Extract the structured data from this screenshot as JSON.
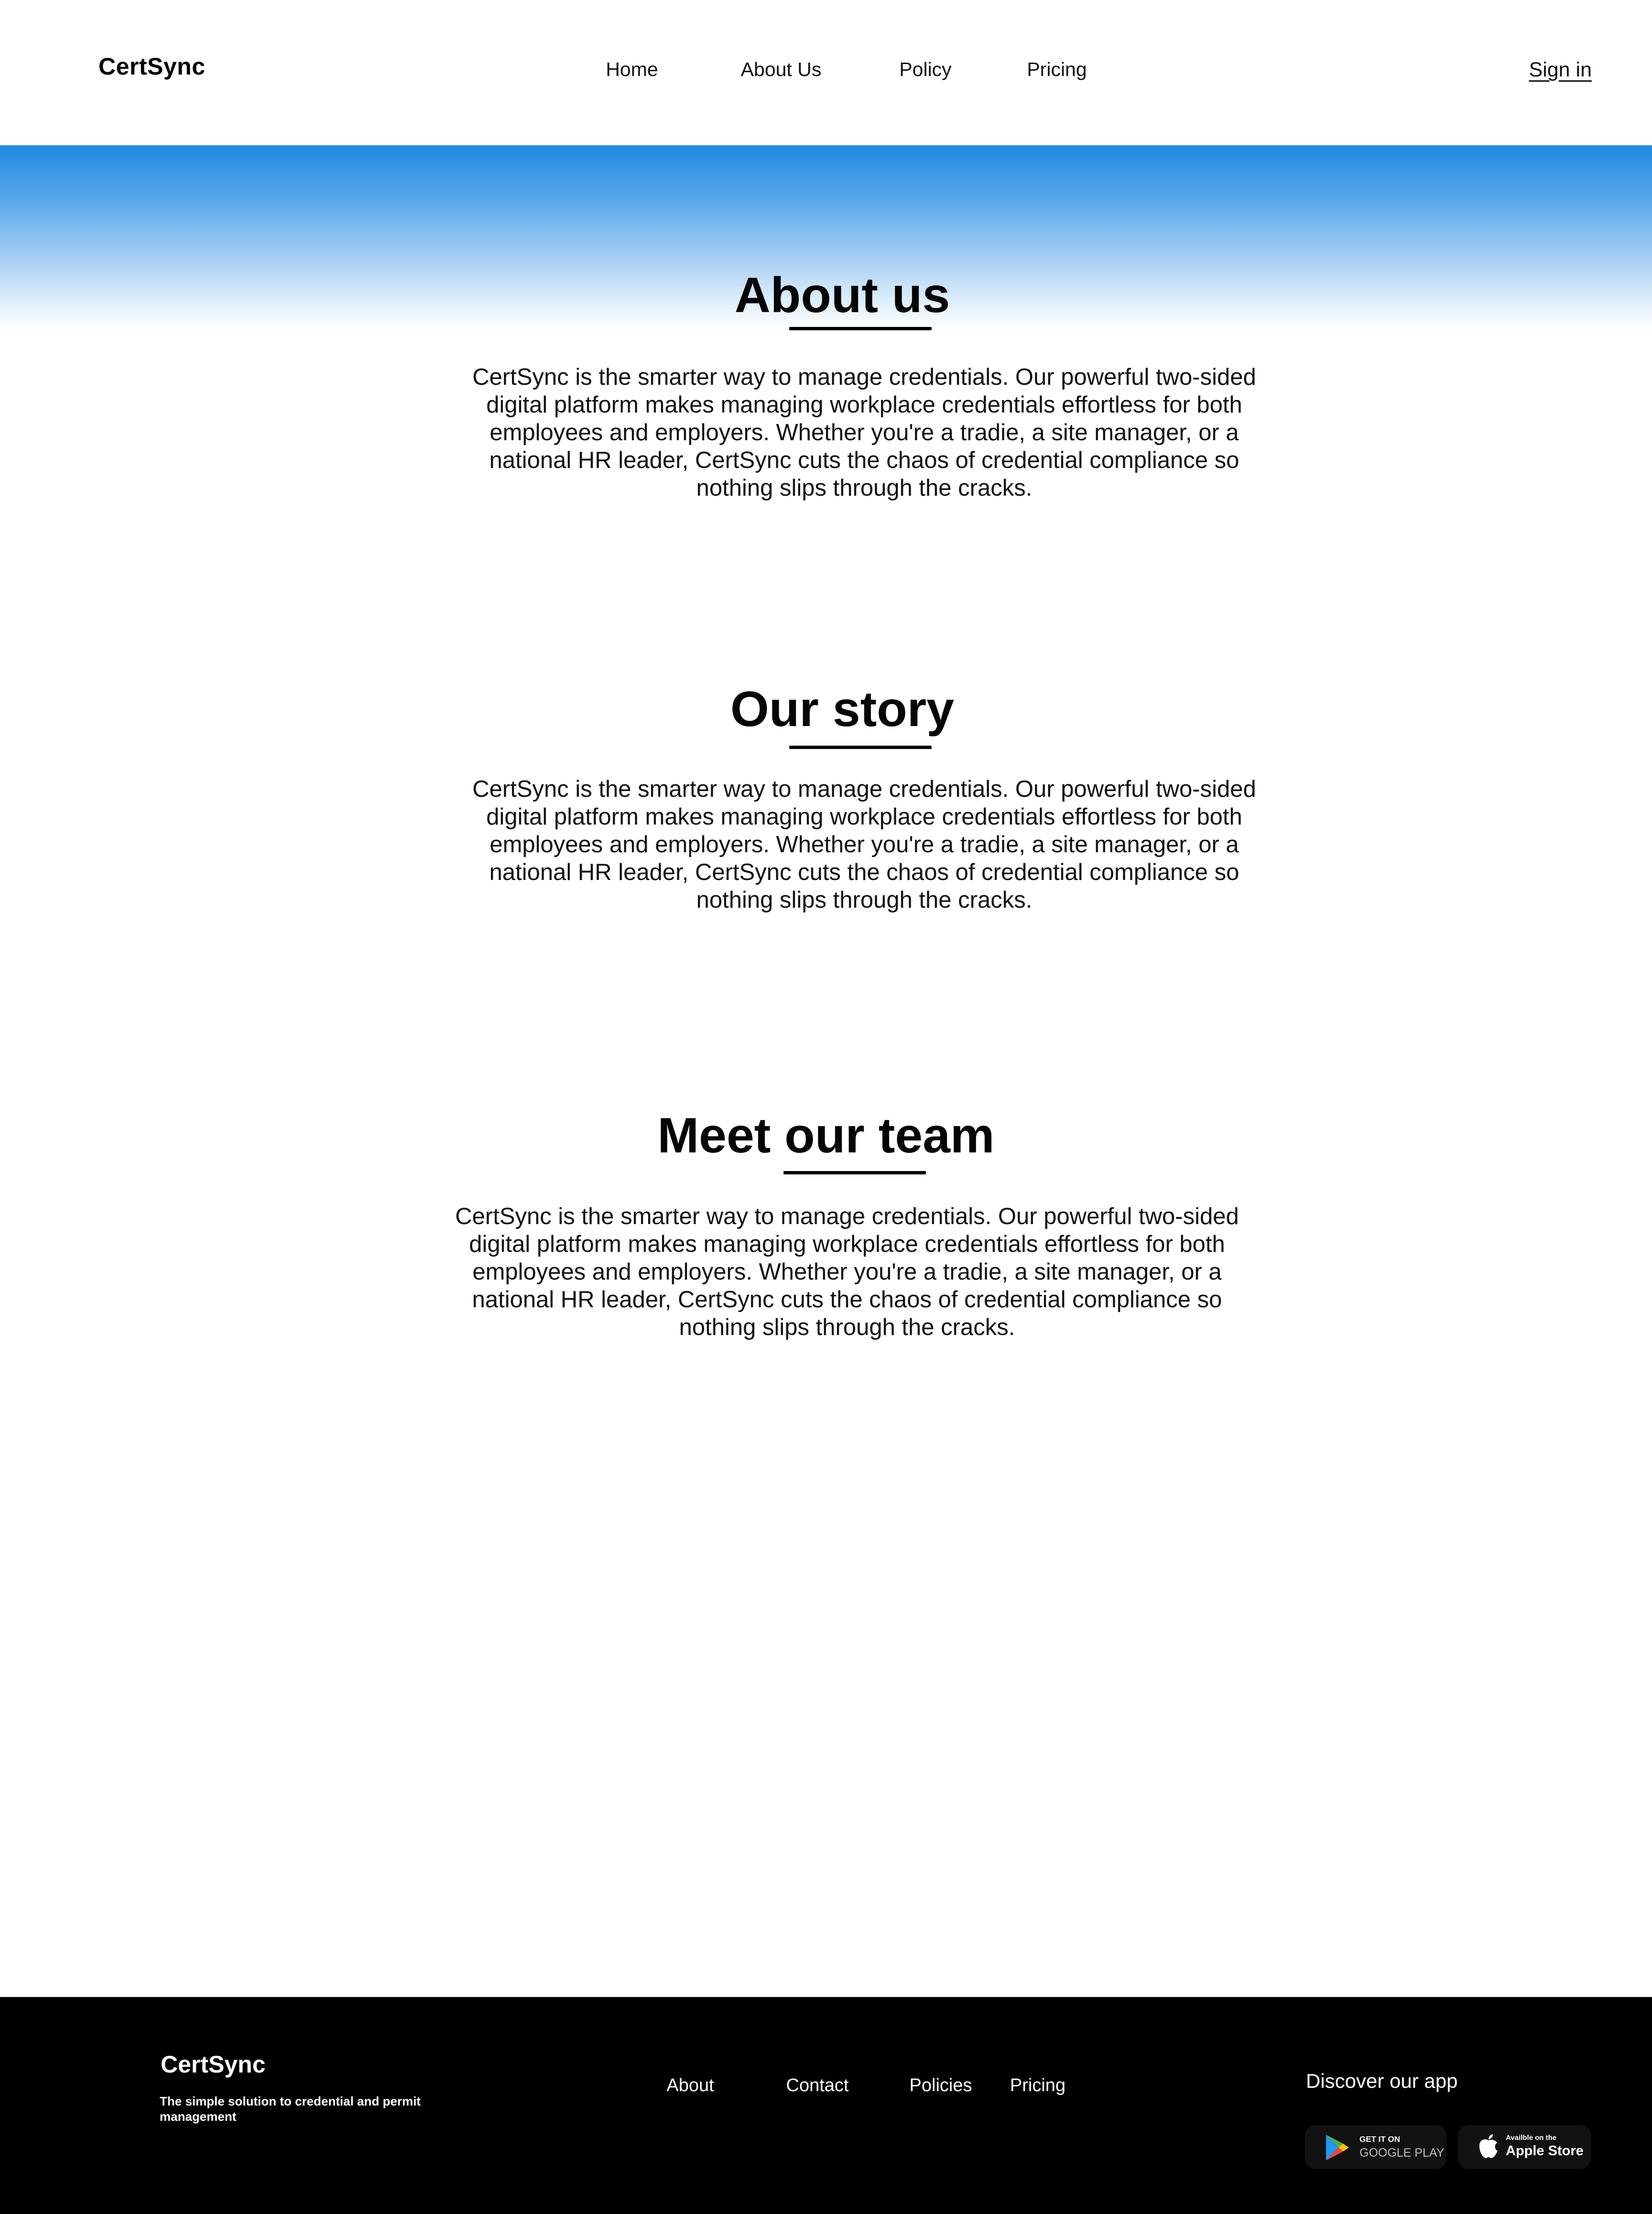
{
  "header": {
    "logo": "CertSync",
    "nav": [
      {
        "label": "Home"
      },
      {
        "label": "About Us"
      },
      {
        "label": "Policy"
      },
      {
        "label": "Pricing"
      }
    ],
    "sign_in": "Sign in"
  },
  "sections": [
    {
      "title": "About us",
      "body": "CertSync is the smarter way to manage credentials. Our powerful two-sided digital platform makes managing workplace credentials effortless for both employees and employers. Whether you're a tradie, a site manager, or a national HR leader, CertSync cuts the chaos of credential compliance so nothing slips through the cracks."
    },
    {
      "title": "Our story",
      "body": "CertSync is the smarter way to manage credentials. Our powerful two-sided digital platform makes managing workplace credentials effortless for both employees and employers. Whether you're a tradie, a site manager, or a national HR leader, CertSync cuts the chaos of credential compliance so nothing slips through the cracks."
    },
    {
      "title": "Meet our team",
      "body": "CertSync is the smarter way to manage credentials. Our powerful two-sided digital platform makes managing workplace credentials effortless for both employees and employers. Whether you're a tradie, a site manager, or a national HR leader, CertSync cuts the chaos of credential compliance so nothing slips through the cracks."
    }
  ],
  "footer": {
    "logo": "CertSync",
    "tagline": "The simple solution to credential and permit management",
    "links": [
      {
        "label": "About"
      },
      {
        "label": "Contact"
      },
      {
        "label": "Policies"
      },
      {
        "label": "Pricing"
      }
    ],
    "discover": "Discover our app",
    "badges": {
      "google": {
        "small": "GET IT ON",
        "big": "GOOGLE PLAY",
        "icon": "google-play-icon"
      },
      "apple": {
        "small": "Availble on the",
        "big": "Apple Store",
        "icon": "apple-icon"
      }
    }
  },
  "colors": {
    "hero_top": "#1e8ae2",
    "background": "#ffffff",
    "footer_background": "#000000",
    "badge_background": "#121212"
  }
}
